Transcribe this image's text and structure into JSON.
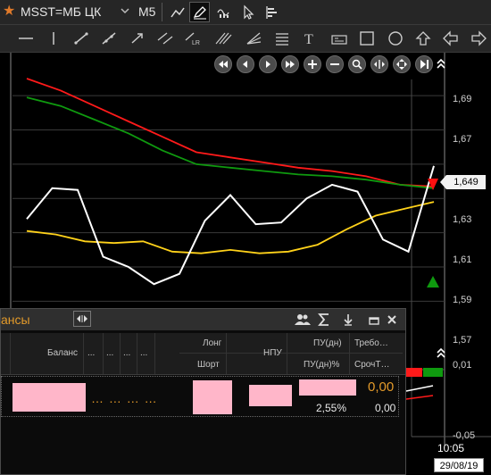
{
  "toolbar": {
    "symbol": "MSST=МБ ЦК",
    "timeframe": "M5"
  },
  "axis": {
    "y_ticks": [
      "1,69",
      "1,67",
      "1,65",
      "1,63",
      "1,61",
      "1,59",
      "1,57",
      "0,01",
      "-0,05"
    ],
    "current_price": "1,649",
    "time": "10:05",
    "date": "29/08/19"
  },
  "panel": {
    "title": "ансы",
    "cols": {
      "balance": "Баланс",
      "dots": "...",
      "long": "Лонг",
      "short": "Шорт",
      "npu": "НПУ",
      "pu_dn": "ПУ(дн)",
      "pu_dn_pct": "ПУ(дн)%",
      "treb": "Требо…",
      "sroch": "СрочТ…"
    },
    "row": {
      "dots": "… … … …",
      "pu_dn": "0,00",
      "pu_dn_pct": "2,55%",
      "sroch": "0,00"
    }
  },
  "chart_data": {
    "type": "line",
    "ylim": [
      1.565,
      1.7
    ],
    "series": [
      {
        "color": "#ff1a1a",
        "values": [
          1.7,
          1.693,
          1.684,
          1.675,
          1.666,
          1.657,
          1.654,
          1.651,
          1.648,
          1.646,
          1.643,
          1.638,
          1.637
        ]
      },
      {
        "color": "#0f9a0f",
        "values": [
          1.689,
          1.684,
          1.676,
          1.668,
          1.658,
          1.65,
          1.648,
          1.646,
          1.644,
          1.643,
          1.641,
          1.638,
          1.636
        ]
      },
      {
        "color": "#ffd21a",
        "values": [
          1.611,
          1.609,
          1.605,
          1.604,
          1.605,
          1.599,
          1.598,
          1.6,
          1.598,
          1.599,
          1.603,
          1.612,
          1.62,
          1.624,
          1.628
        ]
      },
      {
        "color": "#ffffff",
        "values": [
          1.618,
          1.636,
          1.635,
          1.596,
          1.59,
          1.58,
          1.586,
          1.617,
          1.632,
          1.615,
          1.616,
          1.63,
          1.638,
          1.634,
          1.606,
          1.599,
          1.649
        ]
      }
    ]
  },
  "colors": {
    "accent_orange": "#e39a2a",
    "background": "#000000",
    "toolbar": "#262626",
    "highlight_pink": "#ffb6c9"
  }
}
